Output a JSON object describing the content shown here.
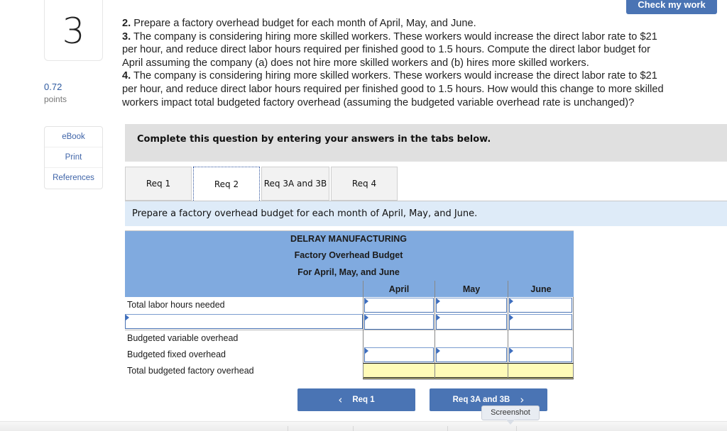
{
  "question": {
    "number": "3",
    "points_value": "0.72",
    "points_label": "points"
  },
  "side_links": [
    "eBook",
    "Print",
    "References"
  ],
  "check_button": "Check my work",
  "instructions": [
    {
      "num": "2.",
      "text": " Prepare a factory overhead budget for each month of April, May, and June."
    },
    {
      "num": "3.",
      "text": " The company is considering hiring more skilled workers. These workers would increase the direct labor rate to $21"
    },
    {
      "num": "",
      "text": "per hour, and reduce direct labor hours required per finished good to 1.5 hours. Compute the direct labor budget for"
    },
    {
      "num": "",
      "text": "April assuming the company (a) does not hire more skilled workers and (b) hires more skilled workers."
    },
    {
      "num": "4.",
      "text": " The company is considering hiring more skilled workers. These workers would increase the direct labor rate to $21"
    },
    {
      "num": "",
      "text": "per hour, and reduce direct labor hours required per finished good to 1.5 hours. How would this change to more skilled"
    },
    {
      "num": "",
      "text": "workers impact total budgeted factory overhead (assuming the budgeted variable overhead rate is unchanged)?"
    }
  ],
  "complete_banner": "Complete this question by entering your answers in the tabs below.",
  "tabs": [
    {
      "label": "Req 1",
      "active": false
    },
    {
      "label": "Req 2",
      "active": true
    },
    {
      "label": "Req 3A and 3B",
      "active": false
    },
    {
      "label": "Req 4",
      "active": false
    }
  ],
  "task_text": "Prepare a factory overhead budget for each month of April, May, and June.",
  "budget": {
    "company": "DELRAY MANUFACTURING",
    "title": "Factory Overhead Budget",
    "period": "For April, May, and June",
    "columns": [
      "April",
      "May",
      "June"
    ],
    "rows": [
      {
        "label": "Total labor hours needed",
        "values": [
          "",
          "",
          ""
        ]
      },
      {
        "label": "",
        "values": [
          "",
          "",
          ""
        ]
      },
      {
        "label": "Budgeted variable overhead",
        "values": [
          "",
          "",
          ""
        ]
      },
      {
        "label": "Budgeted fixed overhead",
        "values": [
          "",
          "",
          ""
        ]
      },
      {
        "label": "Total budgeted factory overhead",
        "values": [
          "",
          "",
          ""
        ]
      }
    ]
  },
  "nav": {
    "prev_label": "Req 1",
    "next_label": "Req 3A and 3B",
    "prev_icon": "chevron-left-icon",
    "next_icon": "chevron-right-icon"
  },
  "tooltip": "Screenshot",
  "colors": {
    "accent": "#4a74b4",
    "table_header": "#80aadf",
    "total_row": "#fffbb8",
    "task_bar": "#deebf8",
    "banner": "#e0e0e0"
  }
}
